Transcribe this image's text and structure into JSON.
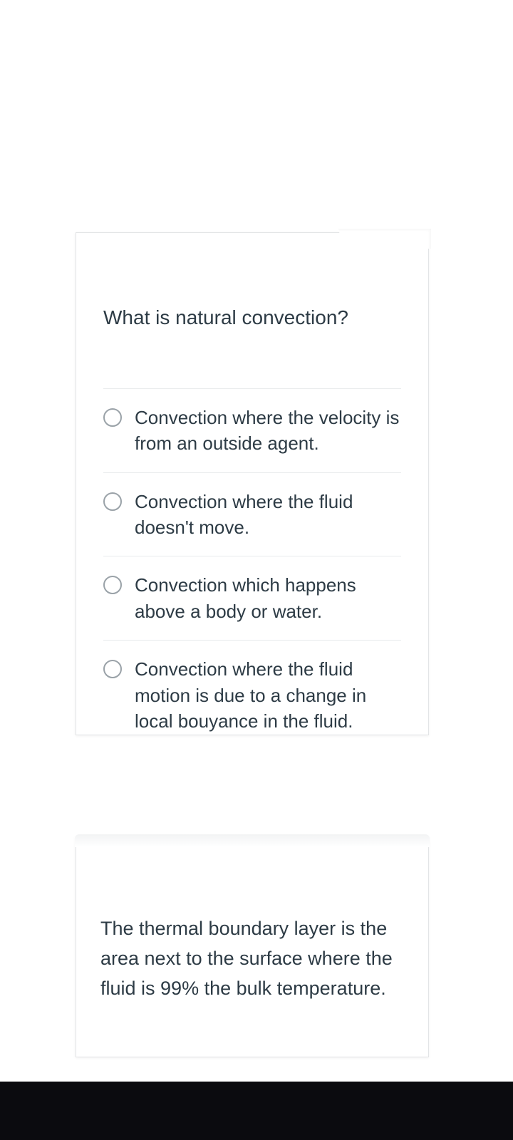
{
  "question1": {
    "prompt": "What is natural convection?",
    "options": [
      "Convection where the velocity is from an outside agent.",
      "Convection where the fluid doesn't move.",
      "Convection which happens above a body or water.",
      "Convection where the fluid motion is due to a change in local bouyance in the fluid."
    ]
  },
  "question2": {
    "statement": "The thermal boundary layer is the area next to the surface where the fluid is 99% the bulk temperature."
  }
}
